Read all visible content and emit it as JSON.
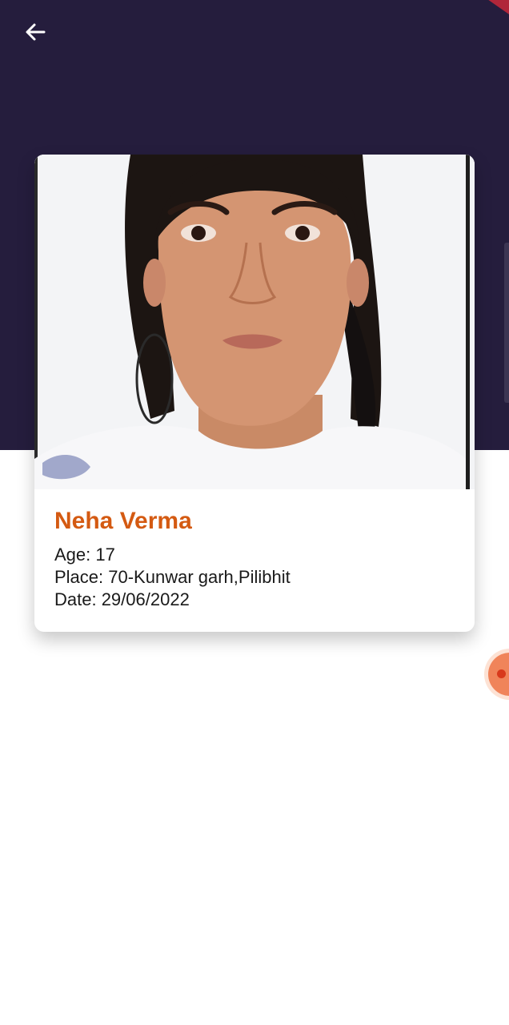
{
  "header": {
    "back_icon": "arrow-left-icon",
    "background_color": "#251d3d"
  },
  "profile": {
    "name": "Neha Verma",
    "age_line": "Age: 17",
    "place_line": "Place: 70-Kunwar garh,Pilibhit",
    "date_line": "Date: 29/06/2022",
    "name_color": "#d45a12"
  },
  "fab": {
    "icon": "floating-dot-icon",
    "color": "#f0845a"
  }
}
